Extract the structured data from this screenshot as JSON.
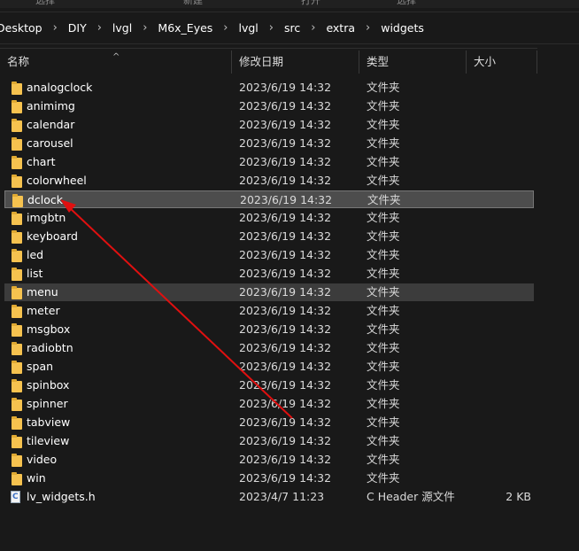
{
  "toolbar_partial": [
    "选择",
    "新建",
    "打开",
    "选择"
  ],
  "breadcrumb": [
    "Desktop",
    "DIY",
    "lvgl",
    "M6x_Eyes",
    "lvgl",
    "src",
    "extra",
    "widgets"
  ],
  "columns": {
    "name": "名称",
    "date": "修改日期",
    "type": "类型",
    "size": "大小"
  },
  "files": [
    {
      "name": "analogclock",
      "date": "2023/6/19 14:32",
      "type": "文件夹",
      "size": "",
      "icon": "folder-icon"
    },
    {
      "name": "animimg",
      "date": "2023/6/19 14:32",
      "type": "文件夹",
      "size": "",
      "icon": "folder-icon"
    },
    {
      "name": "calendar",
      "date": "2023/6/19 14:32",
      "type": "文件夹",
      "size": "",
      "icon": "folder-icon"
    },
    {
      "name": "carousel",
      "date": "2023/6/19 14:32",
      "type": "文件夹",
      "size": "",
      "icon": "folder-icon"
    },
    {
      "name": "chart",
      "date": "2023/6/19 14:32",
      "type": "文件夹",
      "size": "",
      "icon": "folder-icon"
    },
    {
      "name": "colorwheel",
      "date": "2023/6/19 14:32",
      "type": "文件夹",
      "size": "",
      "icon": "folder-icon"
    },
    {
      "name": "dclock",
      "date": "2023/6/19 14:32",
      "type": "文件夹",
      "size": "",
      "icon": "folder-icon",
      "state": "selected"
    },
    {
      "name": "imgbtn",
      "date": "2023/6/19 14:32",
      "type": "文件夹",
      "size": "",
      "icon": "folder-icon"
    },
    {
      "name": "keyboard",
      "date": "2023/6/19 14:32",
      "type": "文件夹",
      "size": "",
      "icon": "folder-icon"
    },
    {
      "name": "led",
      "date": "2023/6/19 14:32",
      "type": "文件夹",
      "size": "",
      "icon": "folder-icon"
    },
    {
      "name": "list",
      "date": "2023/6/19 14:32",
      "type": "文件夹",
      "size": "",
      "icon": "folder-icon"
    },
    {
      "name": "menu",
      "date": "2023/6/19 14:32",
      "type": "文件夹",
      "size": "",
      "icon": "folder-icon",
      "state": "highlight"
    },
    {
      "name": "meter",
      "date": "2023/6/19 14:32",
      "type": "文件夹",
      "size": "",
      "icon": "folder-icon"
    },
    {
      "name": "msgbox",
      "date": "2023/6/19 14:32",
      "type": "文件夹",
      "size": "",
      "icon": "folder-icon"
    },
    {
      "name": "radiobtn",
      "date": "2023/6/19 14:32",
      "type": "文件夹",
      "size": "",
      "icon": "folder-icon"
    },
    {
      "name": "span",
      "date": "2023/6/19 14:32",
      "type": "文件夹",
      "size": "",
      "icon": "folder-icon"
    },
    {
      "name": "spinbox",
      "date": "2023/6/19 14:32",
      "type": "文件夹",
      "size": "",
      "icon": "folder-icon"
    },
    {
      "name": "spinner",
      "date": "2023/6/19 14:32",
      "type": "文件夹",
      "size": "",
      "icon": "folder-icon"
    },
    {
      "name": "tabview",
      "date": "2023/6/19 14:32",
      "type": "文件夹",
      "size": "",
      "icon": "folder-icon"
    },
    {
      "name": "tileview",
      "date": "2023/6/19 14:32",
      "type": "文件夹",
      "size": "",
      "icon": "folder-icon"
    },
    {
      "name": "video",
      "date": "2023/6/19 14:32",
      "type": "文件夹",
      "size": "",
      "icon": "folder-icon"
    },
    {
      "name": "win",
      "date": "2023/6/19 14:32",
      "type": "文件夹",
      "size": "",
      "icon": "folder-icon"
    },
    {
      "name": "lv_widgets.h",
      "date": "2023/4/7 11:23",
      "type": "C Header 源文件",
      "size": "2 KB",
      "icon": "c-header-file-icon"
    }
  ],
  "colors": {
    "background": "#191919",
    "selected_row": "#4d4d4d",
    "folder": "#f6c24f",
    "annotation_arrow": "#e01010"
  }
}
